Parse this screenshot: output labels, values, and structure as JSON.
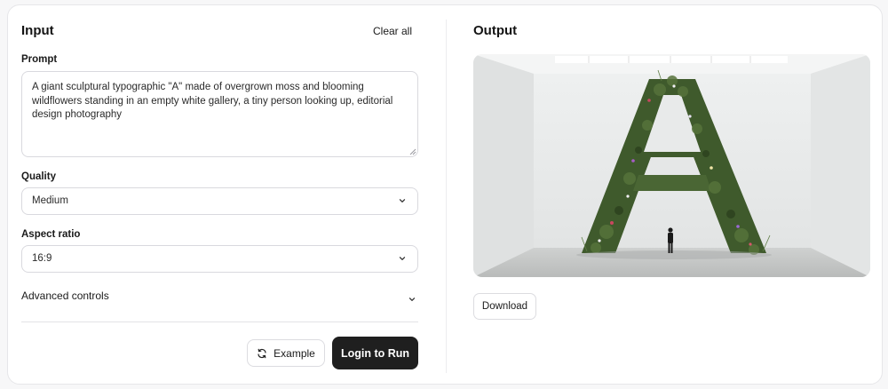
{
  "input": {
    "title": "Input",
    "clear_label": "Clear all",
    "prompt_label": "Prompt",
    "prompt_value": "A giant sculptural typographic \"A\" made of overgrown moss and blooming wildflowers standing in an empty white gallery, a tiny person looking up, editorial design photography",
    "quality_label": "Quality",
    "quality_value": "Medium",
    "aspect_label": "Aspect ratio",
    "aspect_value": "16:9",
    "advanced_label": "Advanced controls",
    "example_label": "Example",
    "run_label": "Login to Run"
  },
  "output": {
    "title": "Output",
    "download_label": "Download"
  },
  "icons": {
    "dropdown": "chevron-down-icon",
    "example": "refresh-icon",
    "resize": "resize-grip-icon"
  },
  "colors": {
    "primary_button": "#1f1f1f",
    "border": "#d9d9de",
    "moss": "#3f5a2c"
  }
}
